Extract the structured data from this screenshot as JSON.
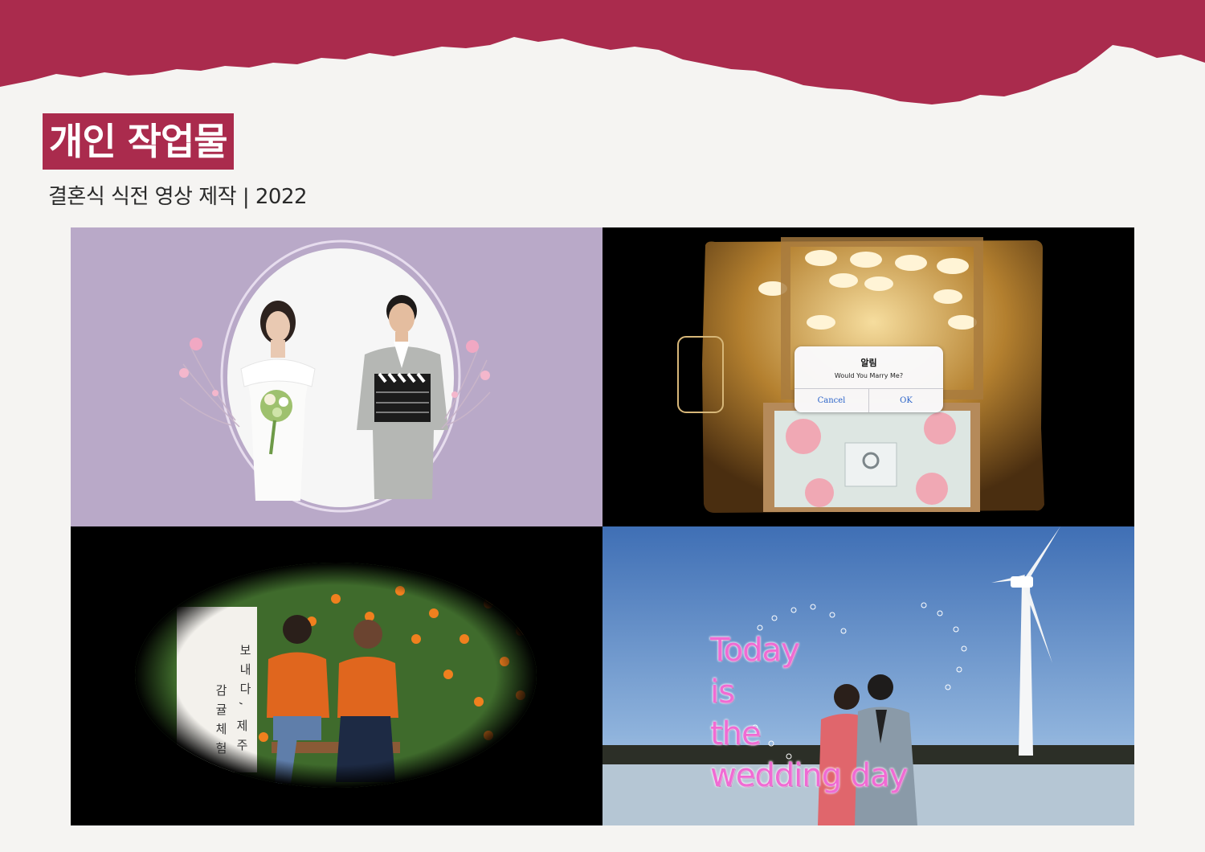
{
  "header": {
    "title": "개인 작업물",
    "subtitle": "결혼식 식전 영상 제작 | 2022"
  },
  "colors": {
    "accent": "#aa2b4d",
    "page_background": "#f5f4f2",
    "lavender_panel": "#b9a9c8",
    "text_pink": "#f06bd3"
  },
  "tiles": {
    "couple_frame": {
      "icons": [
        "oval-frame-icon",
        "pink-flower-icon",
        "clapperboard-icon"
      ]
    },
    "proposal_alert": {
      "alert_title": "알림",
      "alert_message": "Would You Marry Me?",
      "cancel_label": "Cancel",
      "ok_label": "OK"
    },
    "tangerine_orchard": {
      "banner_col1": "보내다,",
      "banner_col2": "감귤체험",
      "banner_col3": "제주"
    },
    "wedding_day": {
      "line1": "Today",
      "line2": "is",
      "line3": "the",
      "line4": "wedding day"
    }
  }
}
